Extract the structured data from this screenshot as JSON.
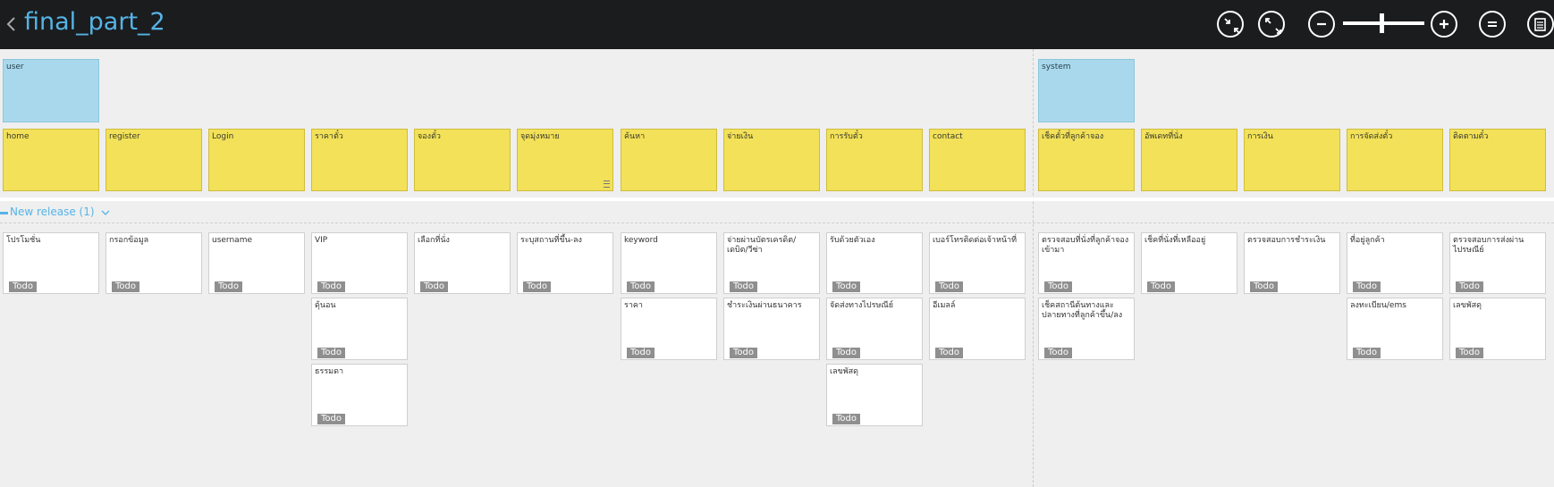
{
  "header": {
    "title": "final_part_2",
    "back_icon": "chevron-left-icon",
    "toolbar_icons": [
      "collapse-icon",
      "expand-icon",
      "zoom-out-icon",
      "zoom-in-icon",
      "menu-icon",
      "notes-icon"
    ]
  },
  "colors": {
    "topbar": "#1b1c1e",
    "title": "#55b4e6",
    "blue_card": "#a9d8ec",
    "yellow_card": "#f2e159",
    "todo_badge": "#8f8f8f"
  },
  "actors": [
    {
      "label": "user"
    },
    {
      "label": "system"
    }
  ],
  "activities": [
    {
      "label": "home"
    },
    {
      "label": "register"
    },
    {
      "label": "Login"
    },
    {
      "label": "ราคาตั๋ว"
    },
    {
      "label": "จองตั๋ว"
    },
    {
      "label": "จุดมุ่งหมาย"
    },
    {
      "label": "ค้นหา"
    },
    {
      "label": "จ่ายเงิน"
    },
    {
      "label": "การรับตั๋ว"
    },
    {
      "label": "contact"
    },
    {
      "label": "เช็คตั๋วที่ลูกค้าจอง"
    },
    {
      "label": "อัพเดทที่นั่ง"
    },
    {
      "label": "การเงิน"
    },
    {
      "label": "การจัดส่งตั๋ว"
    },
    {
      "label": "ติดตามตั๋ว"
    }
  ],
  "release": {
    "label": "New release (1)"
  },
  "stories": [
    {
      "label": "โปรโมชั่น",
      "status": "Todo"
    },
    {
      "label": "กรอกข้อมูล",
      "status": "Todo"
    },
    {
      "label": "username",
      "status": "Todo"
    },
    {
      "label": "VIP",
      "status": "Todo"
    },
    {
      "label": "ดุ้นอน",
      "status": "Todo"
    },
    {
      "label": "ธรรมดา",
      "status": "Todo"
    },
    {
      "label": "เลือกที่นั่ง",
      "status": "Todo"
    },
    {
      "label": "ระบุสถานที่ขึ้น-ลง",
      "status": "Todo"
    },
    {
      "label": "keyword",
      "status": "Todo"
    },
    {
      "label": "ราคา",
      "status": "Todo"
    },
    {
      "label": "จ่ายผ่านบัตรเครดิต/เดบิต/วีซ่า",
      "status": "Todo"
    },
    {
      "label": "ชำระเงินผ่านธนาคาร",
      "status": "Todo"
    },
    {
      "label": "รับด้วยตัวเอง",
      "status": "Todo"
    },
    {
      "label": "จัดส่งทางไปรษณีย์",
      "status": "Todo"
    },
    {
      "label": "เลขพัสดุ",
      "status": "Todo"
    },
    {
      "label": "เบอร์โทรติดต่อเจ้าหน้าที่",
      "status": "Todo"
    },
    {
      "label": "อีเมลล์",
      "status": "Todo"
    },
    {
      "label": "ตรวจสอบที่นั่งที่ลูกค้าจองเข้ามา",
      "status": "Todo"
    },
    {
      "label": "เช็คสถานีต้นทางและปลายทางที่ลูกค้าขึ้น/ลง",
      "status": "Todo"
    },
    {
      "label": "เช็คที่นั่งที่เหลืออยู่",
      "status": "Todo"
    },
    {
      "label": "ตรวจสอบการชำระเงิน",
      "status": "Todo"
    },
    {
      "label": "ที่อยู่ลูกค้า",
      "status": "Todo"
    },
    {
      "label": "ลงทะเบียน/ems",
      "status": "Todo"
    },
    {
      "label": "ตรวจสอบการส่งผ่านไปรษณีย์",
      "status": "Todo"
    },
    {
      "label": "เลขพัสดุ",
      "status": "Todo"
    }
  ]
}
